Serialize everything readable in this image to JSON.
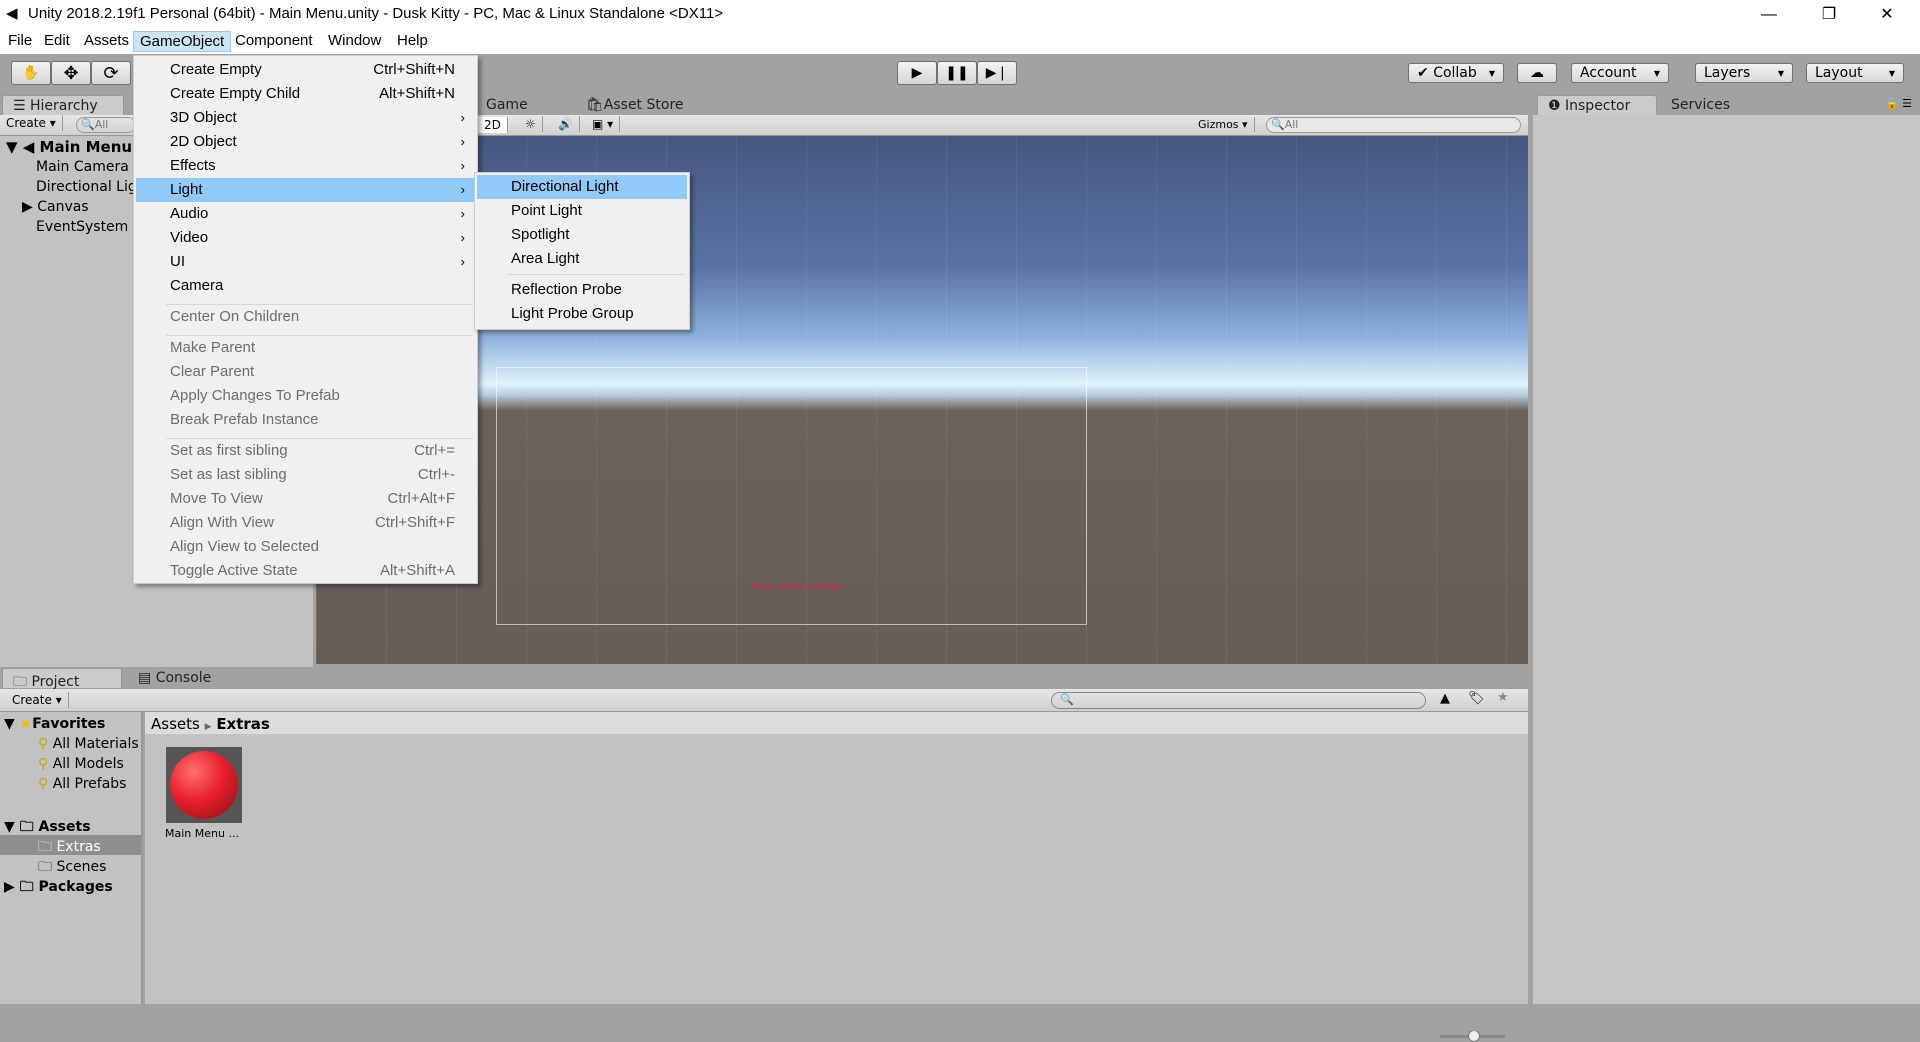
{
  "window": {
    "title": "Unity 2018.2.19f1 Personal (64bit) - Main Menu.unity - Dusk Kitty - PC, Mac & Linux Standalone <DX11>",
    "minimize": "—",
    "restore": "❐",
    "close": "✕"
  },
  "menubar": [
    "File",
    "Edit",
    "Assets",
    "GameObject",
    "Component",
    "Window",
    "Help"
  ],
  "toolbar": {
    "collab": "Collab",
    "account": "Account",
    "layers": "Layers",
    "layout": "Layout"
  },
  "hierarchy": {
    "tab": "Hierarchy",
    "create": "Create",
    "search_placeholder": "All",
    "scene": "Main Menu",
    "items": [
      "Main Camera",
      "Directional Light",
      "Canvas",
      "EventSystem"
    ]
  },
  "scene_tabs": {
    "game": "Game",
    "asset_store": "Asset Store",
    "mode_2d": "2D",
    "gizmos": "Gizmos",
    "search_placeholder": "All"
  },
  "scene": {
    "ui_text": "Press Enter to Begin"
  },
  "inspector": {
    "tabs": [
      "Inspector",
      "Services"
    ]
  },
  "gameobject_menu": {
    "items": [
      {
        "label": "Create Empty",
        "shortcut": "Ctrl+Shift+N"
      },
      {
        "label": "Create Empty Child",
        "shortcut": "Alt+Shift+N"
      },
      {
        "label": "3D Object",
        "submenu": true
      },
      {
        "label": "2D Object",
        "submenu": true
      },
      {
        "label": "Effects",
        "submenu": true
      },
      {
        "label": "Light",
        "submenu": true,
        "highlighted": true
      },
      {
        "label": "Audio",
        "submenu": true
      },
      {
        "label": "Video",
        "submenu": true
      },
      {
        "label": "UI",
        "submenu": true
      },
      {
        "label": "Camera"
      },
      {
        "label": "Center On Children",
        "disabled": true
      },
      {
        "label": "Make Parent",
        "disabled": true
      },
      {
        "label": "Clear Parent",
        "disabled": true
      },
      {
        "label": "Apply Changes To Prefab",
        "disabled": true
      },
      {
        "label": "Break Prefab Instance",
        "disabled": true
      },
      {
        "label": "Set as first sibling",
        "shortcut": "Ctrl+=",
        "disabled": true
      },
      {
        "label": "Set as last sibling",
        "shortcut": "Ctrl+-",
        "disabled": true
      },
      {
        "label": "Move To View",
        "shortcut": "Ctrl+Alt+F",
        "disabled": true
      },
      {
        "label": "Align With View",
        "shortcut": "Ctrl+Shift+F",
        "disabled": true
      },
      {
        "label": "Align View to Selected",
        "disabled": true
      },
      {
        "label": "Toggle Active State",
        "shortcut": "Alt+Shift+A",
        "disabled": true
      }
    ],
    "arrow": "›"
  },
  "light_submenu": [
    "Directional Light",
    "Point Light",
    "Spotlight",
    "Area Light",
    "Reflection Probe",
    "Light Probe Group"
  ],
  "project": {
    "tabs": [
      "Project",
      "Console"
    ],
    "create": "Create",
    "favorites": {
      "label": "Favorites",
      "items": [
        "All Materials",
        "All Models",
        "All Prefabs"
      ]
    },
    "assets": {
      "label": "Assets",
      "items": [
        "Extras",
        "Scenes"
      ]
    },
    "packages": "Packages",
    "breadcrumb": [
      "Assets",
      "Extras"
    ],
    "files": [
      {
        "name": "Main Menu ..."
      }
    ]
  },
  "colors": {
    "highlight": "#91c9f7",
    "selected_folder": "#8f8f8f",
    "scene_text": "#d8283c"
  }
}
